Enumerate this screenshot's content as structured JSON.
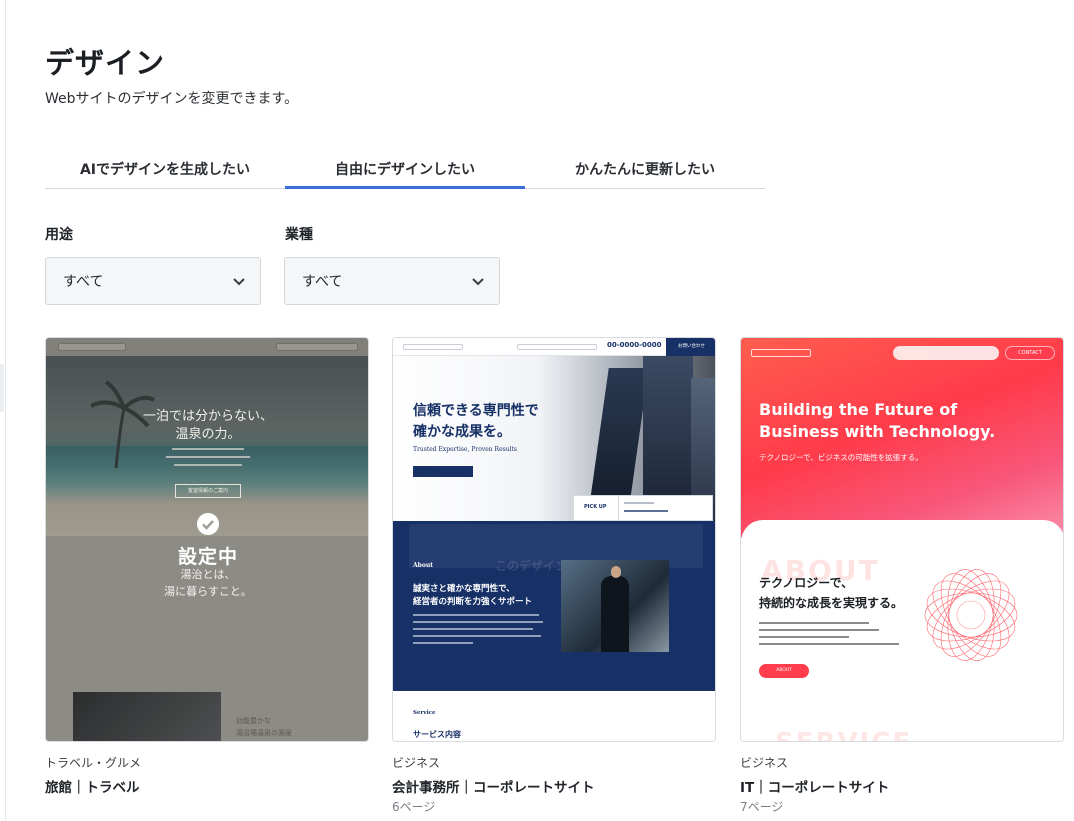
{
  "page": {
    "title": "デザイン",
    "subtitle": "Webサイトのデザインを変更できます。"
  },
  "tabs": [
    {
      "label": "AIでデザインを生成したい",
      "active": false
    },
    {
      "label": "自由にデザインしたい",
      "active": true
    },
    {
      "label": "かんたんに更新したい",
      "active": false
    }
  ],
  "filters": {
    "purpose": {
      "label": "用途",
      "value": "すべて"
    },
    "industry": {
      "label": "業種",
      "value": "すべて"
    }
  },
  "colors": {
    "accent": "#3b6fd8",
    "navy": "#173066",
    "it_red": "#ff3d4c"
  },
  "cards": [
    {
      "category": "トラベル・グルメ",
      "name": "旅館｜トラベル",
      "pages": "",
      "status": "設定中",
      "preview": {
        "headline_1": "一泊では分からない、",
        "headline_2": "温泉の力。",
        "cta": "客室情報のご案内",
        "section_1": "湯治とは、",
        "section_2": "湯に暮らすこと。",
        "feature_1": "効能豊かな",
        "feature_2": "湯治場温泉の源泉"
      }
    },
    {
      "category": "ビジネス",
      "name": "会計事務所｜コーポレートサイト",
      "pages": "6ページ",
      "preview": {
        "phone": "00-0000-0000",
        "contact": "お問い合わせ",
        "headline_1": "信頼できる専門性で",
        "headline_2": "確かな成果を。",
        "tagline": "Trusted Expertise, Proven Results",
        "pickup": "PICK UP",
        "about": "About",
        "about_head_1": "誠実さと確かな専門性で、",
        "about_head_2": "経営者の判断を力強くサポート",
        "hover": "このデザイン",
        "service": "Service",
        "service_jp": "サービス内容"
      }
    },
    {
      "category": "ビジネス",
      "name": "IT｜コーポレートサイト",
      "pages": "7ページ",
      "preview": {
        "contact": "CONTACT",
        "headline_1": "Building the Future of",
        "headline_2": "Business with Technology.",
        "sub": "テクノロジーで、ビジネスの可能性を拡張する。",
        "about_watermark": "ABOUT",
        "about_head_1": "テクノロジーで、",
        "about_head_2": "持続的な成長を実現する。",
        "about_btn": "ABOUT",
        "service_watermark": "SERVICE"
      }
    }
  ]
}
